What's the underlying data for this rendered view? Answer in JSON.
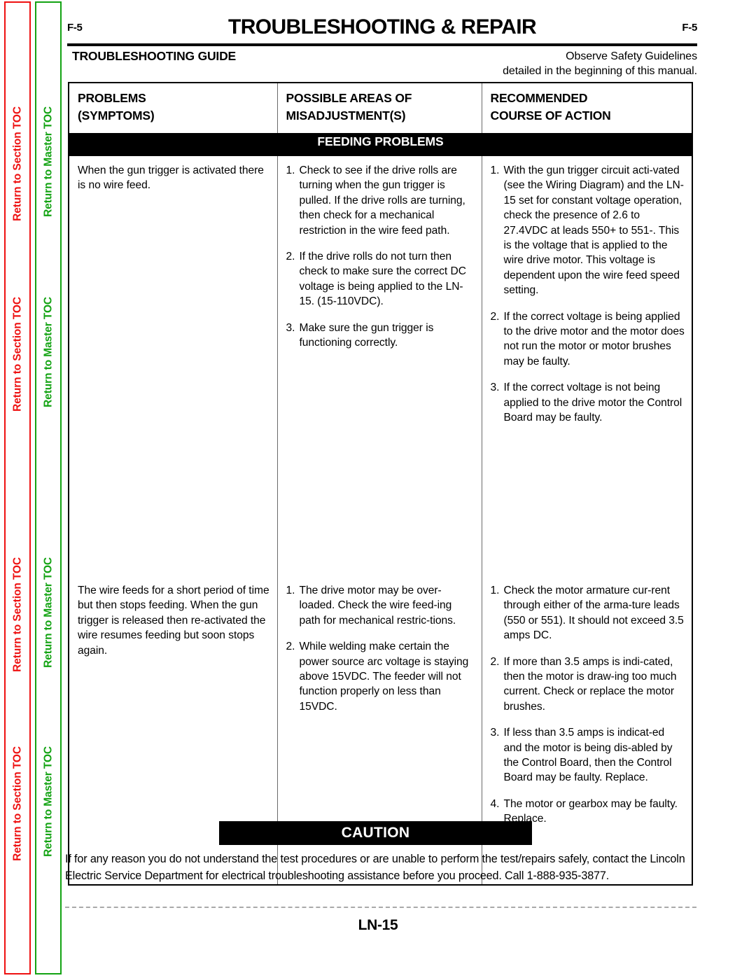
{
  "sidebar": {
    "section_toc_label": "Return to Section TOC",
    "master_toc_label": "Return to Master TOC",
    "section_toc_color": "#ee1111",
    "master_toc_color": "#13a313",
    "repeat_count": 4
  },
  "header": {
    "folio_left": "F-5",
    "folio_right": "F-5",
    "title": "TROUBLESHOOTING & REPAIR",
    "guide_title": "TROUBLESHOOTING GUIDE",
    "safety_note_line1": "Observe Safety Guidelines",
    "safety_note_line2": "detailed in the beginning of this manual."
  },
  "table": {
    "headers": {
      "col1_line1": "PROBLEMS",
      "col1_line2": "(SYMPTOMS)",
      "col2_line1": "POSSIBLE AREAS OF",
      "col2_line2": "MISADJUSTMENT(S)",
      "col3_line1": "RECOMMENDED",
      "col3_line2": "COURSE OF ACTION"
    },
    "section_band": "FEEDING PROBLEMS",
    "rows": [
      {
        "problem": "When the gun trigger is activated there is no wire feed.",
        "misadjustments": [
          {
            "n": "1.",
            "text": "Check to see if the drive rolls are turning when the gun trigger is pulled.  If the drive rolls are turning, then check for a mechanical restriction in the wire feed path."
          },
          {
            "n": "2.",
            "text": "If the drive rolls do not turn then check to make sure the correct DC voltage is being applied to the LN-15.  (15-110VDC)."
          },
          {
            "n": "3.",
            "text": "Make sure the gun trigger is functioning correctly."
          }
        ],
        "actions": [
          {
            "n": "1.",
            "text": "With the gun trigger circuit acti-vated (see the Wiring Diagram) and the LN-15 set for constant voltage operation, check the presence of 2.6 to 27.4VDC at leads 550+ to 551-.  This is the voltage that is applied to the wire drive motor.  This voltage is dependent upon the wire feed speed setting."
          },
          {
            "n": "2.",
            "text": "If the correct voltage is being applied to the drive motor and the motor does not run the motor or motor brushes may be faulty."
          },
          {
            "n": "3.",
            "text": "If the correct voltage is not being applied to the drive motor the Control Board may be faulty."
          }
        ]
      },
      {
        "problem": "The wire feeds for a short period of time but then stops feeding. When the gun trigger is released then re-activated the wire resumes feeding but soon stops again.",
        "misadjustments": [
          {
            "n": "1.",
            "text": "The drive motor may be over-loaded.  Check the wire feed-ing path for mechanical restric-tions."
          },
          {
            "n": "2.",
            "text": "While welding make certain the power source arc voltage is staying above 15VDC.  The feeder will not function properly on less than 15VDC."
          }
        ],
        "actions": [
          {
            "n": "1.",
            "text": "Check the motor armature cur-rent through either of the arma-ture leads (550 or 551).   It should not exceed 3.5 amps DC."
          },
          {
            "n": "2.",
            "text": "If more than 3.5 amps is indi-cated, then the motor is draw-ing too much current.  Check or replace the motor brushes."
          },
          {
            "n": "3.",
            "text": "If less than 3.5 amps is indicat-ed and the motor is being dis-abled by the Control Board, then the Control Board may be faulty.  Replace."
          },
          {
            "n": "4.",
            "text": "The motor or gearbox may be faulty.  Replace."
          }
        ]
      }
    ]
  },
  "caution": {
    "banner": "CAUTION",
    "text": "If for any reason you do not understand the test procedures or are unable to perform the test/repairs safely, contact the Lincoln Electric Service Department for electrical troubleshooting assistance before you proceed.  Call 1-888-935-3877."
  },
  "footer": {
    "model": "LN-15"
  }
}
